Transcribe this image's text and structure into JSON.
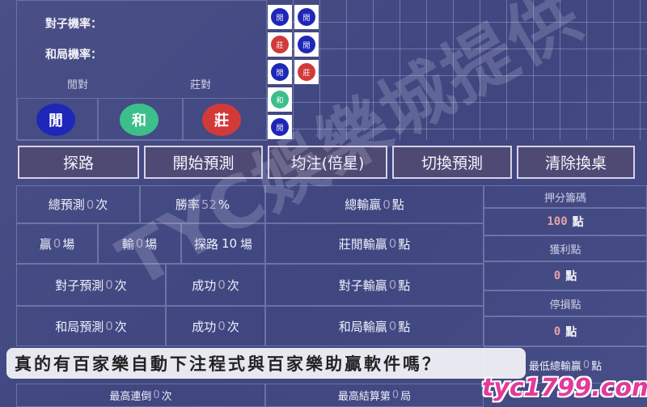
{
  "stats_top": {
    "pair_rate_label": "對子機率：",
    "tie_rate_label": "和局機率：",
    "player_pair_label": "閒對",
    "banker_pair_label": "莊對"
  },
  "bets": {
    "player": "閒",
    "tie": "和",
    "banker": "莊"
  },
  "road": {
    "player_char": "閒",
    "banker_char": "莊",
    "tie_char": "和"
  },
  "toolbar": {
    "explore": "探路",
    "start_predict": "開始預測",
    "flat_bet": "均注(倍星)",
    "switch_predict": "切換預測",
    "clear_table": "清除換桌"
  },
  "stats": {
    "total_predict_label": "總預測",
    "total_predict_value": "0",
    "unit_times": "次",
    "win_rate_label": "勝率",
    "win_rate_value": "52",
    "percent": "%",
    "total_win_loss_label": "總輸贏",
    "total_win_loss_value": "0",
    "unit_points": "點",
    "win_label": "贏",
    "win_value": "0",
    "unit_games": "場",
    "loss_label": "輸",
    "loss_value": "0",
    "explore_label": "探路",
    "explore_value": "10",
    "banker_player_wl_label": "莊閒輸贏",
    "banker_player_wl_value": "0",
    "pair_predict_label": "對子預測",
    "pair_predict_value": "0",
    "success_label": "成功",
    "pair_success_value": "0",
    "pair_wl_label": "對子輸贏",
    "pair_wl_value": "0",
    "tie_predict_label": "和局預測",
    "tie_predict_value": "0",
    "tie_success_value": "0",
    "tie_wl_label": "和局輸贏",
    "tie_wl_value": "0",
    "max_streak_label": "最高連倒",
    "max_streak_value": "0",
    "max_settle_label": "最高結算第",
    "max_settle_value": "0",
    "unit_rounds": "局",
    "min_total_label": "最低總輸贏",
    "min_total_value": "0"
  },
  "side": {
    "bet_chips_label": "押分籌碼",
    "bet_chips_value": "100",
    "profit_label": "獲利點",
    "profit_value": "0",
    "stop_loss_label": "停損點",
    "stop_loss_value": "0",
    "unit_points": "點"
  },
  "watermark": "TYC娛樂城提供",
  "caption": "真的有百家樂自動下注程式與百家樂助贏軟件嗎？",
  "site": "tyc1799.com",
  "colors": {
    "player": "#1f27b8",
    "banker": "#d23a3a",
    "tie": "#3dbf8c"
  }
}
